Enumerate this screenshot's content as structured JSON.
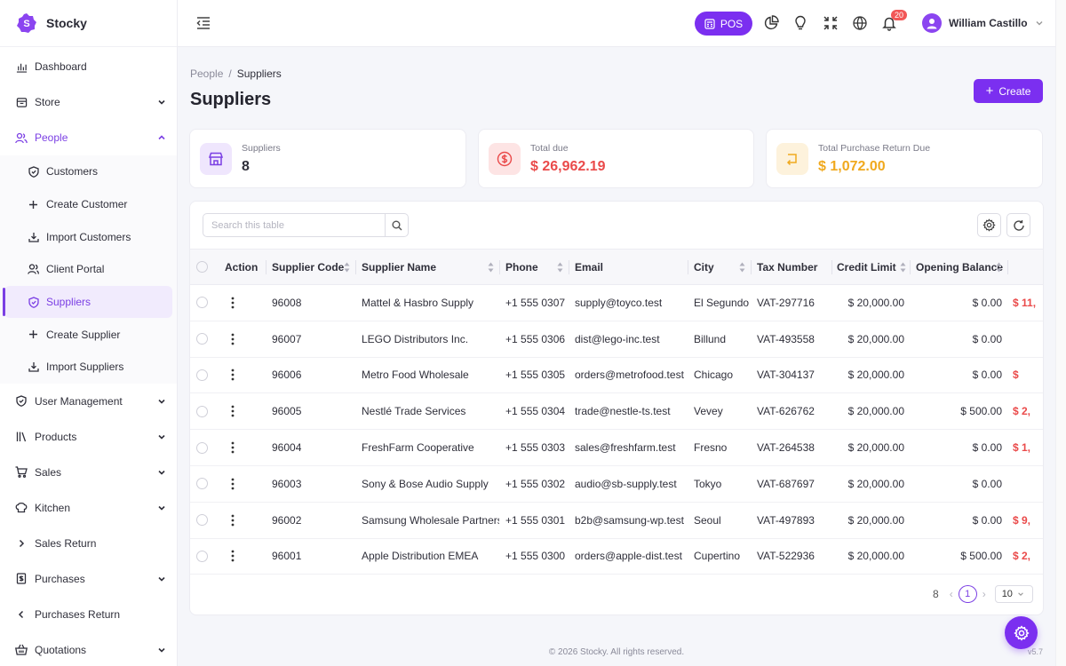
{
  "brand": {
    "name": "Stocky"
  },
  "sidebar": {
    "items_top": [
      {
        "label": "Dashboard",
        "icon": "bar-chart-icon"
      },
      {
        "label": "Store",
        "icon": "store-icon"
      }
    ],
    "people": {
      "label": "People",
      "icon": "users-icon"
    },
    "people_sub": [
      {
        "label": "Customers",
        "icon": "shield-icon"
      },
      {
        "label": "Create Customer",
        "icon": "plus-icon"
      },
      {
        "label": "Import Customers",
        "icon": "download-icon"
      },
      {
        "label": "Client Portal",
        "icon": "user-icon"
      },
      {
        "label": "Suppliers",
        "icon": "shield-icon"
      },
      {
        "label": "Create Supplier",
        "icon": "plus-icon"
      },
      {
        "label": "Import Suppliers",
        "icon": "download-icon"
      }
    ],
    "items_bottom": [
      {
        "label": "User Management",
        "icon": "shield-icon"
      },
      {
        "label": "Products",
        "icon": "books-icon"
      },
      {
        "label": "Sales",
        "icon": "cart-icon"
      },
      {
        "label": "Kitchen",
        "icon": "chef-hat-icon"
      },
      {
        "label": "Sales Return",
        "icon": "chevron-right-icon"
      },
      {
        "label": "Purchases",
        "icon": "receipt-icon"
      },
      {
        "label": "Purchases Return",
        "icon": "chevron-left-icon"
      },
      {
        "label": "Quotations",
        "icon": "basket-icon"
      }
    ]
  },
  "topbar": {
    "pos_label": "POS",
    "notifications_count": "20",
    "user_name": "William Castillo"
  },
  "breadcrumb": {
    "parent": "People",
    "separator": "/",
    "current": "Suppliers"
  },
  "page": {
    "title": "Suppliers",
    "create_label": "Create"
  },
  "stats": [
    {
      "label": "Suppliers",
      "value": "8",
      "color": "#2f2f3a"
    },
    {
      "label": "Total due",
      "value": "$ 26,962.19",
      "color": "#ea4a4a"
    },
    {
      "label": "Total Purchase Return Due",
      "value": "$ 1,072.00",
      "color": "#f0a91e"
    }
  ],
  "table": {
    "search_placeholder": "Search this table",
    "headers": [
      "Action",
      "Supplier Code",
      "Supplier Name",
      "Phone",
      "Email",
      "City",
      "Tax Number",
      "Credit Limit",
      "Opening Balance"
    ],
    "rows": [
      {
        "code": "96008",
        "name": "Mattel & Hasbro Supply",
        "phone": "+1 555 0307",
        "email": "supply@toyco.test",
        "city": "El Segundo",
        "tax": "VAT-297716",
        "credit": "$ 20,000.00",
        "opening": "$ 0.00",
        "due": "$ 11,"
      },
      {
        "code": "96007",
        "name": "LEGO Distributors Inc.",
        "phone": "+1 555 0306",
        "email": "dist@lego-inc.test",
        "city": "Billund",
        "tax": "VAT-493558",
        "credit": "$ 20,000.00",
        "opening": "$ 0.00",
        "due": ""
      },
      {
        "code": "96006",
        "name": "Metro Food Wholesale",
        "phone": "+1 555 0305",
        "email": "orders@metrofood.test",
        "city": "Chicago",
        "tax": "VAT-304137",
        "credit": "$ 20,000.00",
        "opening": "$ 0.00",
        "due": "$"
      },
      {
        "code": "96005",
        "name": "Nestlé Trade Services",
        "phone": "+1 555 0304",
        "email": "trade@nestle-ts.test",
        "city": "Vevey",
        "tax": "VAT-626762",
        "credit": "$ 20,000.00",
        "opening": "$ 500.00",
        "due": "$ 2,"
      },
      {
        "code": "96004",
        "name": "FreshFarm Cooperative",
        "phone": "+1 555 0303",
        "email": "sales@freshfarm.test",
        "city": "Fresno",
        "tax": "VAT-264538",
        "credit": "$ 20,000.00",
        "opening": "$ 0.00",
        "due": "$ 1,"
      },
      {
        "code": "96003",
        "name": "Sony & Bose Audio Supply",
        "phone": "+1 555 0302",
        "email": "audio@sb-supply.test",
        "city": "Tokyo",
        "tax": "VAT-687697",
        "credit": "$ 20,000.00",
        "opening": "$ 0.00",
        "due": ""
      },
      {
        "code": "96002",
        "name": "Samsung Wholesale Partners",
        "phone": "+1 555 0301",
        "email": "b2b@samsung-wp.test",
        "city": "Seoul",
        "tax": "VAT-497893",
        "credit": "$ 20,000.00",
        "opening": "$ 0.00",
        "due": "$ 9,"
      },
      {
        "code": "96001",
        "name": "Apple Distribution EMEA",
        "phone": "+1 555 0300",
        "email": "orders@apple-dist.test",
        "city": "Cupertino",
        "tax": "VAT-522936",
        "credit": "$ 20,000.00",
        "opening": "$ 500.00",
        "due": "$ 2,"
      }
    ]
  },
  "pagination": {
    "total": "8",
    "current_page": "1",
    "page_size": "10"
  },
  "footer": {
    "copyright": "© 2026 Stocky. All rights reserved.",
    "version": "v5.7"
  },
  "colors": {
    "accent": "#7b2ff0",
    "danger": "#ea4a4a",
    "warning": "#f0a91e"
  }
}
